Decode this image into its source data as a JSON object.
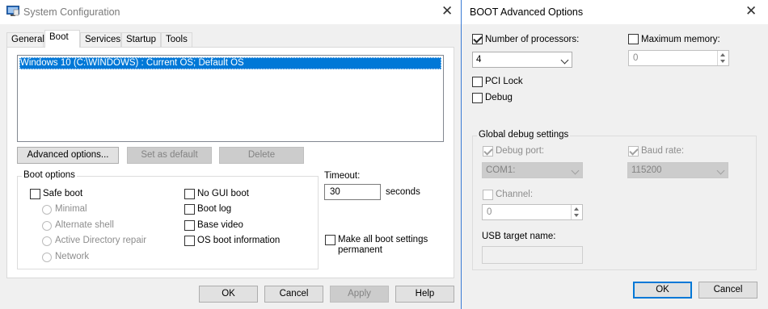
{
  "system_config": {
    "title": "System Configuration",
    "tabs": [
      "General",
      "Boot",
      "Services",
      "Startup",
      "Tools"
    ],
    "active_tab": "Boot",
    "os_entries": [
      "Windows 10 (C:\\WINDOWS) : Current OS; Default OS"
    ],
    "buttons": {
      "advanced": "Advanced options...",
      "set_default": "Set as default",
      "delete": "Delete"
    },
    "boot_options": {
      "group_label": "Boot options",
      "safe_boot": "Safe boot",
      "minimal": "Minimal",
      "alternate_shell": "Alternate shell",
      "active_directory_repair": "Active Directory repair",
      "network": "Network",
      "no_gui_boot": "No GUI boot",
      "boot_log": "Boot log",
      "base_video": "Base video",
      "os_boot_information": "OS boot information"
    },
    "timeout": {
      "label": "Timeout:",
      "value": "30",
      "unit": "seconds"
    },
    "make_permanent_line1": "Make all boot settings",
    "make_permanent_line2": "permanent",
    "footer": {
      "ok": "OK",
      "cancel": "Cancel",
      "apply": "Apply",
      "help": "Help"
    }
  },
  "advanced_options": {
    "title": "BOOT Advanced Options",
    "number_of_processors": {
      "label": "Number of processors:",
      "checked": true,
      "value": "4"
    },
    "maximum_memory": {
      "label": "Maximum memory:",
      "checked": false,
      "value": "0"
    },
    "pci_lock": "PCI Lock",
    "debug": "Debug",
    "global_debug": {
      "group_label": "Global debug settings",
      "debug_port_label": "Debug port:",
      "debug_port_value": "COM1:",
      "baud_rate_label": "Baud rate:",
      "baud_rate_value": "115200",
      "channel_label": "Channel:",
      "channel_value": "0",
      "usb_target_label": "USB target name:",
      "usb_target_value": ""
    },
    "footer": {
      "ok": "OK",
      "cancel": "Cancel"
    }
  },
  "icons": {
    "app": "system-config-icon",
    "close": "close-icon"
  },
  "colors": {
    "selection": "#0078d7",
    "window_bg": "#f0f0f0",
    "panel_bg": "#ffffff",
    "disabled_text": "#838383"
  }
}
